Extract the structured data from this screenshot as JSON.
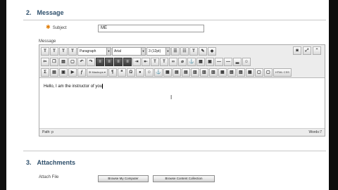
{
  "message_section": {
    "number": "2.",
    "title": "Message",
    "subject_label": "Subject",
    "subject_value": "ME",
    "message_label": "Message"
  },
  "editor": {
    "format_select": "Paragraph",
    "font_select": "Arial",
    "size_select": "3 (12pt)",
    "mashups_label": "Mashups",
    "html_label": "HTML CSS",
    "content": "Hello, I am the instructor of you",
    "path": "Path: p",
    "word_count": "Words:7"
  },
  "attachments_section": {
    "number": "3.",
    "title": "Attachments",
    "attach_label": "Attach File",
    "browse_computer": "Browse My Computer",
    "browse_content": "Browse Content Collection"
  }
}
